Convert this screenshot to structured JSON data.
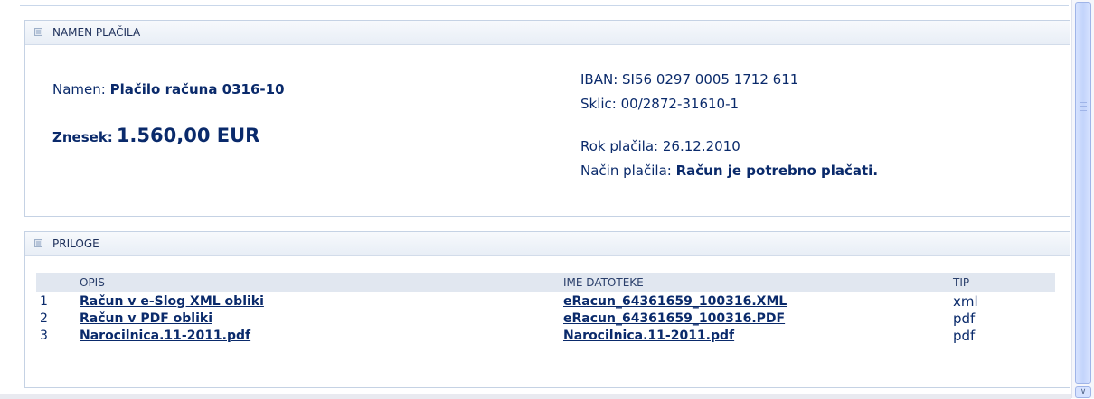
{
  "namen_panel": {
    "title": "NAMEN PLAČILA",
    "namen_label": "Namen:",
    "namen_value": "Plačilo računa 0316-10",
    "znesek_label": "Znesek:",
    "znesek_value": "1.560,00 EUR",
    "iban_label": "IBAN:",
    "iban_value": "SI56 0297 0005 1712 611",
    "sklic_label": "Sklic:",
    "sklic_value": "00/2872-31610-1",
    "rok_label": "Rok plačila:",
    "rok_value": "26.12.2010",
    "nacin_label": "Način plačila:",
    "nacin_value": "Račun je potrebno plačati."
  },
  "priloge_panel": {
    "title": "PRILOGE",
    "columns": {
      "num": "",
      "opis": "OPIS",
      "ime": "IME DATOTEKE",
      "tip": "TIP"
    },
    "rows": [
      {
        "num": "1",
        "opis": "Račun v e-Slog XML obliki",
        "ime": "eRacun_64361659_100316.XML",
        "tip": "xml"
      },
      {
        "num": "2",
        "opis": "Račun v PDF obliki",
        "ime": "eRacun_64361659_100316.PDF",
        "tip": "pdf"
      },
      {
        "num": "3",
        "opis": "Narocilnica.11-2011.pdf",
        "ime": "Narocilnica.11-2011.pdf",
        "tip": "pdf"
      }
    ]
  },
  "icons": {
    "panel_collapse": "panel-collapse-icon",
    "scroll_down": "chevron-down-icon"
  },
  "colors": {
    "text": "#0a2a6b",
    "header_bg": "#e1e7f0",
    "border": "#c5d2e4"
  }
}
